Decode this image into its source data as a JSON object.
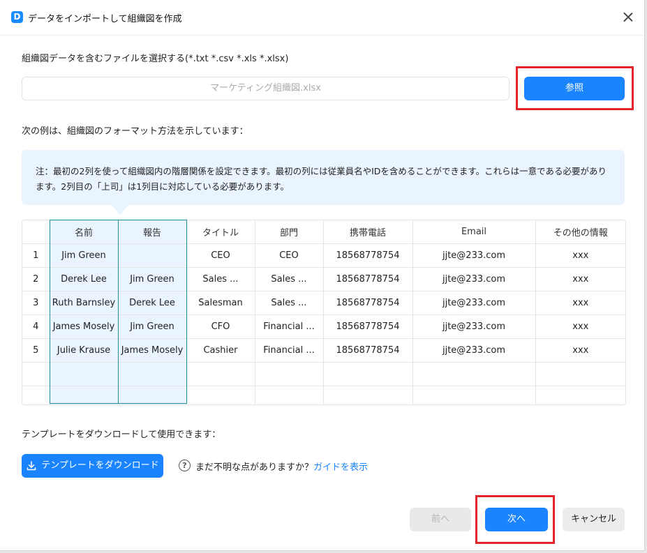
{
  "window": {
    "title": "データをインポートして組織図を作成",
    "app_icon_glyph": "D"
  },
  "file_select": {
    "label": "組織図データを含むファイルを選択する(*.txt *.csv *.xls *.xlsx)",
    "filename": "マーケティング組織図.xlsx",
    "browse_label": "参照"
  },
  "example": {
    "label": "次の例は、組織図のフォーマット方法を示しています：",
    "note": "注：最初の2列を使って組織図内の階層関係を設定できます。最初の列には従業員名やIDを含めることができます。これらは一意である必要があります。2列目の「上司」は1列目に対応している必要があります。"
  },
  "table": {
    "headers": [
      "",
      "名前",
      "報告",
      "タイトル",
      "部門",
      "携帯電話",
      "Email",
      "その他の情報"
    ],
    "rows": [
      [
        "1",
        "Jim Green",
        "",
        "CEO",
        "CEO",
        "18568778754",
        "jjte@233.com",
        "xxx"
      ],
      [
        "2",
        "Derek Lee",
        "Jim Green",
        "Sales ...",
        "Sales ...",
        "18568778754",
        "jjte@233.com",
        "xxx"
      ],
      [
        "3",
        "Ruth Barnsley",
        "Derek Lee",
        "Salesman",
        "Sales ...",
        "18568778754",
        "jjte@233.com",
        "xxx"
      ],
      [
        "4",
        "James Mosely",
        "Jim Green",
        "CFO",
        "Financial ...",
        "18568778754",
        "jjte@233.com",
        "xxx"
      ],
      [
        "5",
        "Julie Krause",
        "James Mosely",
        "Cashier",
        "Financial ...",
        "18568778754",
        "jjte@233.com",
        "xxx"
      ],
      [
        "",
        "",
        "",
        "",
        "",
        "",
        "",
        ""
      ],
      [
        "",
        "",
        "",
        "",
        "",
        "",
        "",
        ""
      ]
    ]
  },
  "template": {
    "label": "テンプレートをダウンロードして使用できます：",
    "download_label": "テンプレートをダウンロード",
    "help_text": "まだ不明な点がありますか？",
    "guide_link": "ガイドを表示",
    "help_glyph": "?"
  },
  "footer": {
    "prev_label": "前へ",
    "next_label": "次へ",
    "cancel_label": "キャンセル"
  },
  "colors": {
    "accent": "#1a84ff",
    "highlight_box": "#e3242b",
    "column_highlight": "#eaf4ff",
    "column_border": "#1f8f99"
  },
  "icons": [
    "app-logo-icon",
    "close-icon",
    "download-icon",
    "help-icon"
  ]
}
